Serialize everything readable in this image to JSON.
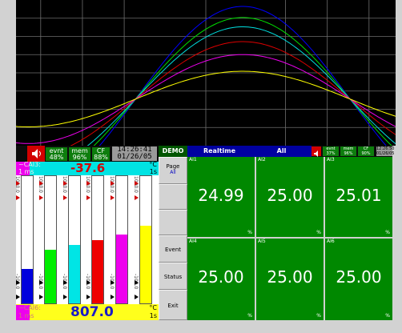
{
  "left_panel": {
    "status": {
      "speaker_icon": "speaker-icon",
      "evnt_label": "evnt",
      "evnt_value": "48%",
      "mem_label": "mem",
      "mem_value": "96%",
      "cf_label": "CF",
      "cf_value": "88%",
      "time": "14:26:41",
      "date": "01/26/05"
    },
    "header_top": {
      "tag": "~CAI3:",
      "rate": "1 ms",
      "value": "-37.6",
      "unit": "°C",
      "interval": "1s",
      "tag_color": "#e8e8e8"
    },
    "header_bottom": {
      "tag": "~CAI6:",
      "rate": "1 ms",
      "value": "807.0",
      "unit": "°C",
      "interval": "1s"
    },
    "bars": [
      {
        "name": "bar-1",
        "color": "#0000dd",
        "level": 0.27,
        "scale_top": "1000.0",
        "scale_bottom": "-100.0"
      },
      {
        "name": "bar-2",
        "color": "#00ee00",
        "level": 0.42,
        "scale_top": "1000.0",
        "scale_bottom": "-100.0"
      },
      {
        "name": "bar-3",
        "color": "#00e5e5",
        "level": 0.46,
        "scale_top": "1000.0",
        "scale_bottom": "-100.0"
      },
      {
        "name": "bar-4",
        "color": "#ee0000",
        "level": 0.5,
        "scale_top": "1000.0",
        "scale_bottom": "-100.0"
      },
      {
        "name": "bar-5",
        "color": "#ee00ee",
        "level": 0.54,
        "scale_top": "1000.0",
        "scale_bottom": "-100.0"
      },
      {
        "name": "bar-6",
        "color": "#ffff00",
        "level": 0.61,
        "scale_top": "1000.0",
        "scale_bottom": "-100.0"
      }
    ]
  },
  "toolbar": {
    "demo": "DEMO",
    "title": "Realtime",
    "group": "All"
  },
  "right_status": {
    "evnt": "evnt",
    "evnt_v": "37%",
    "mem": "mem",
    "mem_v": "96%",
    "cf": "CF",
    "cf_v": "90%",
    "time": "12:26:50",
    "date": "01/26/05"
  },
  "side_buttons": {
    "page": "Page",
    "page_sub": "All",
    "event": "Event",
    "status": "Status",
    "exit": "Exit"
  },
  "cells": [
    {
      "tag": "AI1",
      "value": "24.99",
      "unit": "%"
    },
    {
      "tag": "AI2",
      "value": "25.00",
      "unit": "%"
    },
    {
      "tag": "AI3",
      "value": "25.01",
      "unit": "%"
    },
    {
      "tag": "AI4",
      "value": "25.00",
      "unit": "%"
    },
    {
      "tag": "AI5",
      "value": "25.00",
      "unit": "%"
    },
    {
      "tag": "AI6",
      "value": "25.00",
      "unit": "%"
    }
  ],
  "trend": {
    "colors": [
      "#0000ff",
      "#00e000",
      "#00e0e0",
      "#dd0000",
      "#ee00ee",
      "#ffff00",
      "#ffffff"
    ],
    "amplitudes": [
      1.0,
      0.88,
      0.78,
      0.62,
      0.48,
      0.3
    ],
    "vertical_grid": [
      0.065,
      0.175,
      0.285,
      0.5,
      0.71,
      0.82,
      0.93
    ]
  }
}
